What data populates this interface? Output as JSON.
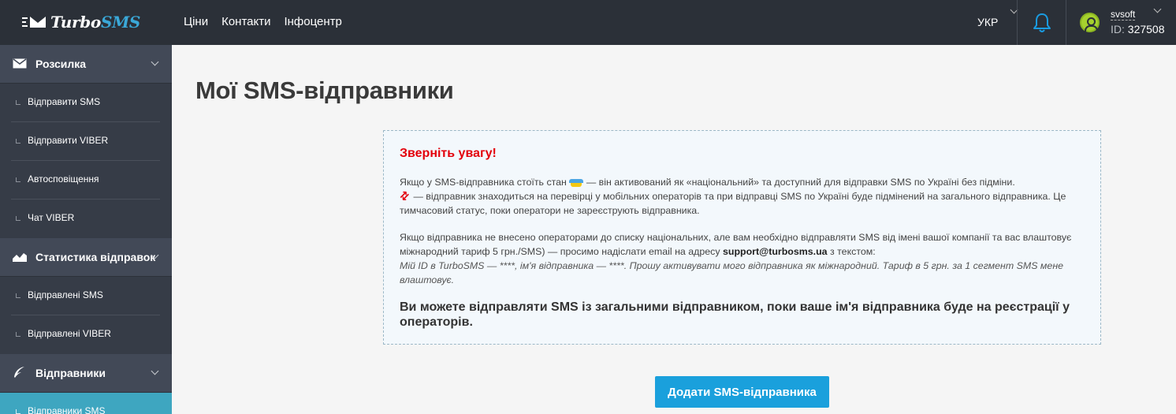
{
  "header": {
    "brand_text": "Turbo",
    "brand_accent": "SMS",
    "nav": [
      "Ціни",
      "Контакти",
      "Інфоцентр"
    ],
    "language": "УКР",
    "user_name": "svsoft",
    "user_id_label": "ID:",
    "user_id": "327508"
  },
  "sidebar": {
    "sections": [
      {
        "label": "Розсилка",
        "icon": "envelope-icon",
        "items": [
          "Відправити SMS",
          "Відправити VIBER",
          "Автосповіщення",
          "Чат VIBER"
        ]
      },
      {
        "label": "Статистика відправок",
        "icon": "chart-icon",
        "items": [
          "Відправлені SMS",
          "Відправлені VIBER"
        ]
      },
      {
        "label": "Відправники",
        "icon": "feather-icon",
        "items": [
          "Відправники SMS"
        ]
      }
    ]
  },
  "main": {
    "title": "Мої SMS-відправники",
    "notice": {
      "heading": "Зверніть увагу!",
      "p1_a": "Якщо у SMS-відправника стоїть стан",
      "p1_b": "— він активований як «національний» та доступний для відправки SMS по Україні без підміни.",
      "p1_c": "— відправник знаходиться на перевірці у мобільних операторів та при відправці SMS по Україні буде підмінений на загального відправника. Це тимчасовий статус, поки оператори не зареєструють відправника.",
      "p2_a": "Якщо відправника не внесено операторами до списку національних, але вам необхідно відправляти SMS від імені вашої компанії та вас влаштовує міжнародний тариф 5 грн./SMS) — просимо надіслати email на адресу",
      "p2_email": "support@turbosms.ua",
      "p2_b": "з текстом:",
      "p2_quote": "Мій ID в TurboSMS — ****, ім'я відправника — ****. Прошу активувати мого відправника як міжнародний. Тариф в 5 грн. за 1 сегмент SMS мене влаштовує.",
      "emphasis": "Ви можете відправляти SMS із загальними відправником, поки ваше ім'я відправника буде на реєстрації у операторів."
    },
    "add_button": "Додати SMS-відправника"
  },
  "colors": {
    "topbar": "#2b3038",
    "sidebar": "#363c47",
    "accent": "#1aa0dc",
    "warning": "#e3000b",
    "active_item": "#3ea6c0"
  }
}
